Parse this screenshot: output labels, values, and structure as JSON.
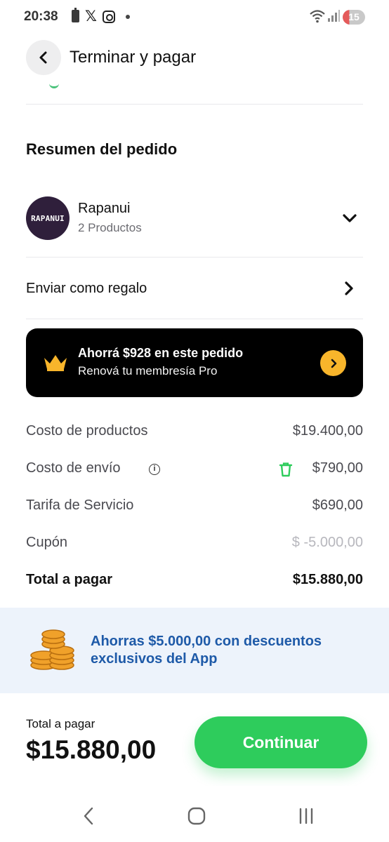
{
  "status_bar": {
    "time": "20:38",
    "battery_level": "15",
    "icons": [
      "battery-saver-icon",
      "x-logo-icon",
      "instagram-icon",
      "notification-dot-icon",
      "wifi-icon",
      "signal-icon"
    ]
  },
  "header": {
    "title": "Terminar y pagar",
    "back_icon": "chevron-left-icon"
  },
  "summary": {
    "title": "Resumen del pedido",
    "store": {
      "logo_text": "RAPANUI",
      "name": "Rapanui",
      "products": "2 Productos",
      "expand_icon": "chevron-down-icon"
    },
    "gift": {
      "label": "Enviar como regalo",
      "icon": "chevron-right-icon"
    }
  },
  "promo": {
    "title": "Ahorrá $928 en este pedido",
    "subtitle": "Renová tu membresía Pro",
    "icon": "crown-icon",
    "accent": "#f8b52b"
  },
  "costs": {
    "products": {
      "label": "Costo de productos",
      "value": "$19.400,00"
    },
    "shipping": {
      "label": "Costo de envío",
      "info_mark": "i",
      "value": "$790,00"
    },
    "service": {
      "label": "Tarifa de Servicio",
      "value": "$690,00"
    },
    "coupon": {
      "label": "Cupón",
      "value": "$ -5.000,00"
    },
    "total": {
      "label": "Total a pagar",
      "value": "$15.880,00"
    }
  },
  "savings": {
    "text": "Ahorras $5.000,00 con descuentos exclusivos del App",
    "icon": "coins-icon",
    "color": "#1e5aa8"
  },
  "footer": {
    "total_label": "Total a pagar",
    "total_amount": "$15.880,00",
    "continue_label": "Continuar",
    "button_color": "#2ecc5c"
  },
  "nav": {
    "icons": [
      "back-nav-icon",
      "home-nav-icon",
      "recents-nav-icon"
    ]
  }
}
